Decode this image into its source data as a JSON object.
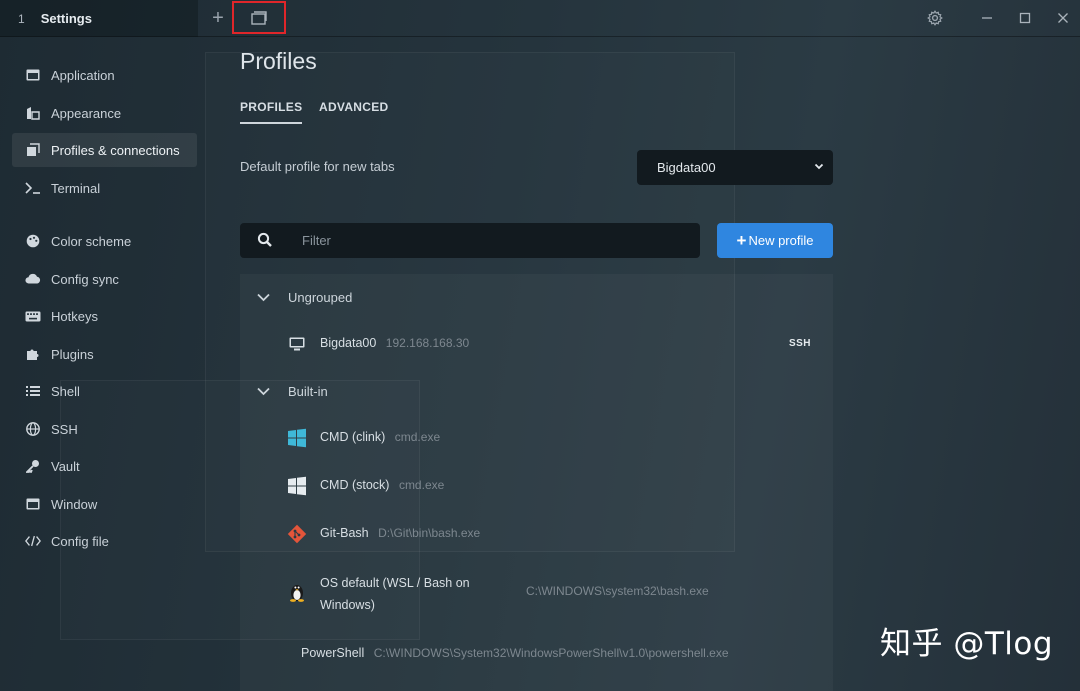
{
  "titlebar": {
    "tab_number": "1",
    "tab_title": "Settings",
    "new_tab_glyph": "+",
    "icons": [
      "plus-icon",
      "window-icon",
      "gear-icon",
      "minimize-icon",
      "maximize-icon",
      "close-icon"
    ]
  },
  "sidebar": {
    "items": [
      {
        "label": "Application",
        "icon": "application-icon"
      },
      {
        "label": "Appearance",
        "icon": "appearance-icon"
      },
      {
        "label": "Profiles & connections",
        "icon": "profiles-icon",
        "active": true
      },
      {
        "label": "Terminal",
        "icon": "terminal-icon"
      },
      {
        "label": "Color scheme",
        "icon": "palette-icon"
      },
      {
        "label": "Config sync",
        "icon": "cloud-icon"
      },
      {
        "label": "Hotkeys",
        "icon": "keyboard-icon"
      },
      {
        "label": "Plugins",
        "icon": "puzzle-icon"
      },
      {
        "label": "Shell",
        "icon": "list-icon"
      },
      {
        "label": "SSH",
        "icon": "globe-icon"
      },
      {
        "label": "Vault",
        "icon": "key-icon"
      },
      {
        "label": "Window",
        "icon": "window-icon"
      },
      {
        "label": "Config file",
        "icon": "code-icon"
      }
    ]
  },
  "main": {
    "title": "Profiles",
    "tabs": [
      "PROFILES",
      "ADVANCED"
    ],
    "default_profile_label": "Default profile for new tabs",
    "default_profile_value": "Bigdata00",
    "filter_placeholder": "Filter",
    "new_profile_label": "New profile",
    "groups": [
      {
        "name": "Ungrouped",
        "profiles": [
          {
            "name": "Bigdata00",
            "desc": "192.168.168.30",
            "badge": "SSH",
            "icon": "monitor-icon"
          }
        ]
      },
      {
        "name": "Built-in",
        "profiles": [
          {
            "name": "CMD (clink)",
            "desc": "cmd.exe",
            "icon": "windows-logo-icon"
          },
          {
            "name": "CMD (stock)",
            "desc": "cmd.exe",
            "icon": "windows-logo-icon"
          },
          {
            "name": "Git-Bash",
            "desc": "D:\\Git\\bin\\bash.exe",
            "icon": "git-icon"
          },
          {
            "name": "OS default (WSL / Bash on",
            "name_line2": "Windows)",
            "desc": "C:\\WINDOWS\\system32\\bash.exe",
            "icon": "linux-penguin-icon"
          },
          {
            "name": "PowerShell",
            "desc": "C:\\WINDOWS\\System32\\WindowsPowerShell\\v1.0\\powershell.exe"
          }
        ]
      }
    ]
  },
  "watermark": "知乎 @Tlog",
  "colors": {
    "accent": "#2f86e0",
    "highlight_box": "#e0262a",
    "windows_cyan": "#3fb8d8",
    "git_red": "#e4553a"
  }
}
